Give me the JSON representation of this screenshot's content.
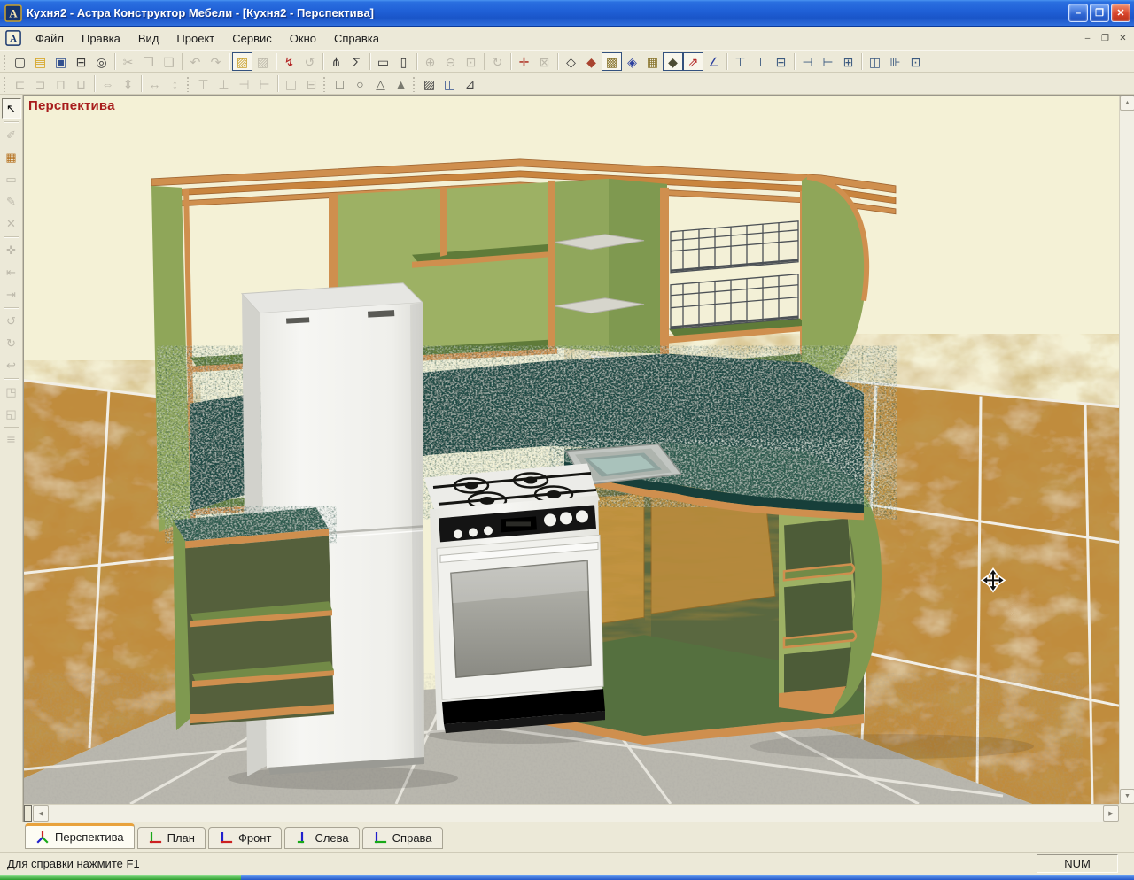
{
  "window": {
    "title": "Кухня2 - Астра Конструктор Мебели - [Кухня2 - Перспектива]",
    "app_icon_letter": "A",
    "controls": [
      {
        "key": "minimize",
        "glyph": "–"
      },
      {
        "key": "restore",
        "glyph": "❐"
      },
      {
        "key": "close",
        "glyph": "✕"
      }
    ]
  },
  "menu": {
    "items": [
      {
        "key": "file",
        "label": "Файл"
      },
      {
        "key": "edit",
        "label": "Правка"
      },
      {
        "key": "view",
        "label": "Вид"
      },
      {
        "key": "project",
        "label": "Проект"
      },
      {
        "key": "service",
        "label": "Сервис"
      },
      {
        "key": "window",
        "label": "Окно"
      },
      {
        "key": "help",
        "label": "Справка"
      }
    ],
    "mdi_controls": [
      {
        "key": "minimize",
        "glyph": "–"
      },
      {
        "key": "restore",
        "glyph": "❐"
      },
      {
        "key": "close",
        "glyph": "✕"
      }
    ]
  },
  "toolbar_row1": [
    {
      "grip": true
    },
    {
      "n": "new-file",
      "g": "▢",
      "c": "#3b3b3b"
    },
    {
      "n": "open-folder",
      "g": "▤",
      "c": "#d4a017"
    },
    {
      "n": "save",
      "g": "▣",
      "c": "#33518f"
    },
    {
      "n": "print",
      "g": "⊟",
      "c": "#3b3b3b"
    },
    {
      "n": "print-preview",
      "g": "◎",
      "c": "#3b3b3b"
    },
    {
      "sep": true
    },
    {
      "n": "cut",
      "g": "✂",
      "s": "disabled"
    },
    {
      "n": "copy",
      "g": "❐",
      "s": "disabled"
    },
    {
      "n": "paste",
      "g": "❏",
      "s": "disabled"
    },
    {
      "sep": true
    },
    {
      "n": "undo",
      "g": "↶",
      "s": "disabled"
    },
    {
      "n": "redo",
      "g": "↷",
      "s": "disabled"
    },
    {
      "sep": true
    },
    {
      "n": "fill-material",
      "g": "▨",
      "c": "#caa22e",
      "s": "selected"
    },
    {
      "n": "clear-material",
      "g": "▨",
      "s": "disabled"
    },
    {
      "sep": true
    },
    {
      "n": "screws",
      "g": "↯",
      "c": "#b22222"
    },
    {
      "n": "rotate-part",
      "g": "↺",
      "s": "disabled"
    },
    {
      "sep": true
    },
    {
      "n": "model-structure",
      "g": "⋔",
      "c": "#3b3b3b"
    },
    {
      "n": "calc-sum",
      "g": "Σ",
      "c": "#3b3b3b"
    },
    {
      "sep": true
    },
    {
      "n": "frame-horizontal",
      "g": "▭",
      "c": "#3b3b3b"
    },
    {
      "n": "frame-vertical",
      "g": "▯",
      "c": "#3b3b3b"
    },
    {
      "sep": true
    },
    {
      "n": "zoom-in",
      "g": "⊕",
      "s": "disabled"
    },
    {
      "n": "zoom-out",
      "g": "⊖",
      "s": "disabled"
    },
    {
      "n": "zoom-actual",
      "g": "⊡",
      "s": "disabled"
    },
    {
      "sep": true
    },
    {
      "n": "orbit-view",
      "g": "↻",
      "s": "disabled"
    },
    {
      "sep": true
    },
    {
      "n": "center-model",
      "g": "✛",
      "c": "#b23b2e"
    },
    {
      "n": "remove-view",
      "g": "⊠",
      "s": "disabled"
    },
    {
      "sep": true
    },
    {
      "n": "view-wireframe",
      "g": "◇",
      "c": "#333333"
    },
    {
      "n": "view-solid",
      "g": "◆",
      "c": "#a8432f"
    },
    {
      "n": "view-textured",
      "g": "▩",
      "c": "#8a7630",
      "s": "selected"
    },
    {
      "n": "view-transparent",
      "g": "◈",
      "c": "#2b3f9e"
    },
    {
      "n": "view-fittings",
      "g": "▦",
      "c": "#8a7630"
    },
    {
      "n": "view-render",
      "g": "◆",
      "c": "#4c4c33",
      "s": "selected"
    },
    {
      "n": "texture-direction",
      "g": "⇗",
      "c": "#b22222",
      "s": "selected"
    },
    {
      "n": "coordinate-axes",
      "g": "∠",
      "c": "#2b3f9e"
    },
    {
      "sep": true
    },
    {
      "n": "panel-top",
      "g": "⊤",
      "c": "#3c5a80"
    },
    {
      "n": "panel-bottom",
      "g": "⊥",
      "c": "#3c5a80"
    },
    {
      "n": "panel-shelf",
      "g": "⊟",
      "c": "#3c5a80"
    },
    {
      "sep": true
    },
    {
      "n": "panel-left",
      "g": "⊣",
      "c": "#3c5a80"
    },
    {
      "n": "panel-right",
      "g": "⊢",
      "c": "#3c5a80"
    },
    {
      "n": "panel-divider",
      "g": "⊞",
      "c": "#3c5a80"
    },
    {
      "sep": true
    },
    {
      "n": "panel-rows",
      "g": "◫",
      "c": "#3c5a80"
    },
    {
      "n": "panel-columns",
      "g": "⊪",
      "c": "#3c5a80"
    },
    {
      "n": "panel-inside",
      "g": "⊡",
      "c": "#3c5a80"
    }
  ],
  "toolbar_row2": [
    {
      "grip": true
    },
    {
      "n": "fit-left",
      "g": "⊏",
      "s": "disabled"
    },
    {
      "n": "fit-right",
      "g": "⊐",
      "s": "disabled"
    },
    {
      "n": "fit-top",
      "g": "⊓",
      "s": "disabled"
    },
    {
      "n": "fit-bottom",
      "g": "⊔",
      "s": "disabled"
    },
    {
      "sep": true
    },
    {
      "n": "stretch-horizontal",
      "g": "⇔",
      "s": "disabled"
    },
    {
      "n": "stretch-vertical",
      "g": "⇕",
      "s": "disabled"
    },
    {
      "sep": true
    },
    {
      "n": "size-width",
      "g": "↔",
      "s": "disabled"
    },
    {
      "n": "size-height",
      "g": "↕",
      "s": "disabled"
    },
    {
      "grip": true
    },
    {
      "n": "attach-top",
      "g": "⊤",
      "s": "disabled"
    },
    {
      "n": "attach-bottom",
      "g": "⊥",
      "s": "disabled"
    },
    {
      "n": "attach-left",
      "g": "⊣",
      "s": "disabled"
    },
    {
      "n": "attach-right",
      "g": "⊢",
      "s": "disabled"
    },
    {
      "sep": true
    },
    {
      "n": "group-panels",
      "g": "◫",
      "s": "disabled"
    },
    {
      "n": "ungroup-panels",
      "g": "⊟",
      "s": "disabled"
    },
    {
      "grip": true
    },
    {
      "n": "primitive-cube",
      "g": "□",
      "c": "#5e5e56"
    },
    {
      "n": "primitive-cylinder",
      "g": "○",
      "c": "#5e5e56"
    },
    {
      "n": "primitive-cone",
      "g": "△",
      "c": "#5e5e56"
    },
    {
      "n": "primitive-pyramid",
      "g": "▲",
      "c": "#7a7a70"
    },
    {
      "grip": true
    },
    {
      "n": "select-texture",
      "g": "▨",
      "c": "#444444"
    },
    {
      "n": "add-door",
      "g": "◫",
      "c": "#33518f"
    },
    {
      "n": "add-worktop",
      "g": "⊿",
      "c": "#444444"
    }
  ],
  "left_palette": [
    {
      "n": "select-tool",
      "g": "↖",
      "s": "active"
    },
    {
      "sep": true
    },
    {
      "n": "paint-material",
      "g": "✐",
      "s": "disabled"
    },
    {
      "n": "add-panel",
      "g": "▦",
      "c": "#b5701e"
    },
    {
      "n": "draw-rectangle",
      "g": "▭",
      "s": "disabled"
    },
    {
      "n": "edit-shape",
      "g": "✎",
      "s": "disabled"
    },
    {
      "n": "delete-object",
      "g": "✕",
      "s": "disabled"
    },
    {
      "sep": true
    },
    {
      "n": "move-object",
      "g": "✜",
      "s": "disabled"
    },
    {
      "n": "offset-left",
      "g": "⇤",
      "s": "disabled"
    },
    {
      "n": "offset-right",
      "g": "⇥",
      "s": "disabled"
    },
    {
      "sep": true
    },
    {
      "n": "rotate-x",
      "g": "↺",
      "s": "disabled"
    },
    {
      "n": "rotate-y",
      "g": "↻",
      "s": "disabled"
    },
    {
      "n": "rotate-z",
      "g": "↩",
      "s": "disabled"
    },
    {
      "sep": true
    },
    {
      "n": "scale-object",
      "g": "◳",
      "s": "disabled"
    },
    {
      "n": "mirror-object",
      "g": "◱",
      "s": "disabled"
    },
    {
      "sep": true
    },
    {
      "n": "object-properties",
      "g": "≣",
      "s": "disabled"
    }
  ],
  "viewport": {
    "label": "Перспектива"
  },
  "tabs": [
    {
      "key": "perspective",
      "label": "Перспектива",
      "active": true
    },
    {
      "key": "plan",
      "label": "План",
      "active": false
    },
    {
      "key": "front",
      "label": "Фронт",
      "active": false
    },
    {
      "key": "left",
      "label": "Слева",
      "active": false
    },
    {
      "key": "right",
      "label": "Справа",
      "active": false
    }
  ],
  "scrollbar": {
    "up": "▲",
    "down": "▼",
    "left": "◀",
    "right": "▶"
  },
  "status": {
    "message": "Для справки нажмите F1",
    "num": "NUM"
  },
  "colors": {
    "titlebar_top": "#3a8ae8",
    "titlebar_bottom": "#1a55c8",
    "titlebar_text": "#ffffff",
    "close_button": "#d8452c",
    "chrome_bg": "#ece9d8",
    "canvas_bg": "#f4f1d6",
    "viewport_label": "#a81c1c",
    "cabinet_green": "#9db164",
    "cabinet_green_dark": "#5f7b39",
    "trim_wood": "#cf8f4e",
    "granite": "#234f49",
    "counter_granite": "#2e5c50",
    "wall_tile": "#c08c3e",
    "grout": "#f2efe6",
    "floor": "#b9b7ae",
    "axis": {
      "red": "#cc2020",
      "green": "#18a818",
      "blue": "#2020cc"
    },
    "taskbar_green": "#43b649",
    "taskbar_blue": "#2f71e0"
  }
}
